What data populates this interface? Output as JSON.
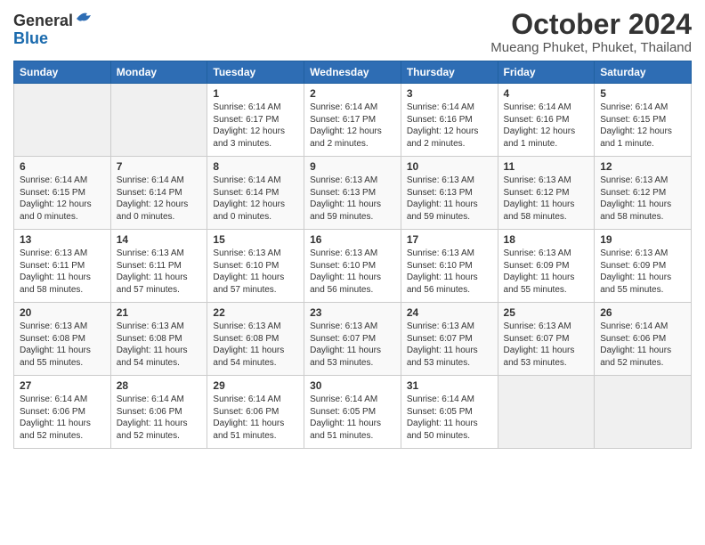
{
  "logo": {
    "general": "General",
    "blue": "Blue"
  },
  "title": "October 2024",
  "location": "Mueang Phuket, Phuket, Thailand",
  "headers": [
    "Sunday",
    "Monday",
    "Tuesday",
    "Wednesday",
    "Thursday",
    "Friday",
    "Saturday"
  ],
  "weeks": [
    [
      {
        "day": "",
        "info": ""
      },
      {
        "day": "",
        "info": ""
      },
      {
        "day": "1",
        "info": "Sunrise: 6:14 AM\nSunset: 6:17 PM\nDaylight: 12 hours\nand 3 minutes."
      },
      {
        "day": "2",
        "info": "Sunrise: 6:14 AM\nSunset: 6:17 PM\nDaylight: 12 hours\nand 2 minutes."
      },
      {
        "day": "3",
        "info": "Sunrise: 6:14 AM\nSunset: 6:16 PM\nDaylight: 12 hours\nand 2 minutes."
      },
      {
        "day": "4",
        "info": "Sunrise: 6:14 AM\nSunset: 6:16 PM\nDaylight: 12 hours\nand 1 minute."
      },
      {
        "day": "5",
        "info": "Sunrise: 6:14 AM\nSunset: 6:15 PM\nDaylight: 12 hours\nand 1 minute."
      }
    ],
    [
      {
        "day": "6",
        "info": "Sunrise: 6:14 AM\nSunset: 6:15 PM\nDaylight: 12 hours\nand 0 minutes."
      },
      {
        "day": "7",
        "info": "Sunrise: 6:14 AM\nSunset: 6:14 PM\nDaylight: 12 hours\nand 0 minutes."
      },
      {
        "day": "8",
        "info": "Sunrise: 6:14 AM\nSunset: 6:14 PM\nDaylight: 12 hours\nand 0 minutes."
      },
      {
        "day": "9",
        "info": "Sunrise: 6:13 AM\nSunset: 6:13 PM\nDaylight: 11 hours\nand 59 minutes."
      },
      {
        "day": "10",
        "info": "Sunrise: 6:13 AM\nSunset: 6:13 PM\nDaylight: 11 hours\nand 59 minutes."
      },
      {
        "day": "11",
        "info": "Sunrise: 6:13 AM\nSunset: 6:12 PM\nDaylight: 11 hours\nand 58 minutes."
      },
      {
        "day": "12",
        "info": "Sunrise: 6:13 AM\nSunset: 6:12 PM\nDaylight: 11 hours\nand 58 minutes."
      }
    ],
    [
      {
        "day": "13",
        "info": "Sunrise: 6:13 AM\nSunset: 6:11 PM\nDaylight: 11 hours\nand 58 minutes."
      },
      {
        "day": "14",
        "info": "Sunrise: 6:13 AM\nSunset: 6:11 PM\nDaylight: 11 hours\nand 57 minutes."
      },
      {
        "day": "15",
        "info": "Sunrise: 6:13 AM\nSunset: 6:10 PM\nDaylight: 11 hours\nand 57 minutes."
      },
      {
        "day": "16",
        "info": "Sunrise: 6:13 AM\nSunset: 6:10 PM\nDaylight: 11 hours\nand 56 minutes."
      },
      {
        "day": "17",
        "info": "Sunrise: 6:13 AM\nSunset: 6:10 PM\nDaylight: 11 hours\nand 56 minutes."
      },
      {
        "day": "18",
        "info": "Sunrise: 6:13 AM\nSunset: 6:09 PM\nDaylight: 11 hours\nand 55 minutes."
      },
      {
        "day": "19",
        "info": "Sunrise: 6:13 AM\nSunset: 6:09 PM\nDaylight: 11 hours\nand 55 minutes."
      }
    ],
    [
      {
        "day": "20",
        "info": "Sunrise: 6:13 AM\nSunset: 6:08 PM\nDaylight: 11 hours\nand 55 minutes."
      },
      {
        "day": "21",
        "info": "Sunrise: 6:13 AM\nSunset: 6:08 PM\nDaylight: 11 hours\nand 54 minutes."
      },
      {
        "day": "22",
        "info": "Sunrise: 6:13 AM\nSunset: 6:08 PM\nDaylight: 11 hours\nand 54 minutes."
      },
      {
        "day": "23",
        "info": "Sunrise: 6:13 AM\nSunset: 6:07 PM\nDaylight: 11 hours\nand 53 minutes."
      },
      {
        "day": "24",
        "info": "Sunrise: 6:13 AM\nSunset: 6:07 PM\nDaylight: 11 hours\nand 53 minutes."
      },
      {
        "day": "25",
        "info": "Sunrise: 6:13 AM\nSunset: 6:07 PM\nDaylight: 11 hours\nand 53 minutes."
      },
      {
        "day": "26",
        "info": "Sunrise: 6:14 AM\nSunset: 6:06 PM\nDaylight: 11 hours\nand 52 minutes."
      }
    ],
    [
      {
        "day": "27",
        "info": "Sunrise: 6:14 AM\nSunset: 6:06 PM\nDaylight: 11 hours\nand 52 minutes."
      },
      {
        "day": "28",
        "info": "Sunrise: 6:14 AM\nSunset: 6:06 PM\nDaylight: 11 hours\nand 52 minutes."
      },
      {
        "day": "29",
        "info": "Sunrise: 6:14 AM\nSunset: 6:06 PM\nDaylight: 11 hours\nand 51 minutes."
      },
      {
        "day": "30",
        "info": "Sunrise: 6:14 AM\nSunset: 6:05 PM\nDaylight: 11 hours\nand 51 minutes."
      },
      {
        "day": "31",
        "info": "Sunrise: 6:14 AM\nSunset: 6:05 PM\nDaylight: 11 hours\nand 50 minutes."
      },
      {
        "day": "",
        "info": ""
      },
      {
        "day": "",
        "info": ""
      }
    ]
  ]
}
